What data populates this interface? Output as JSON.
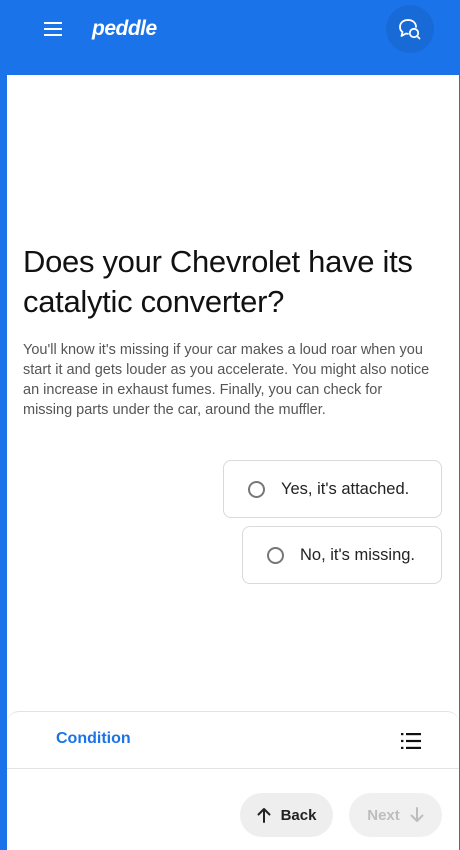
{
  "header": {
    "logo": "peddle",
    "menu_icon": "hamburger-menu-icon",
    "chat_icon": "chat-support-icon"
  },
  "question": {
    "title": "Does your Chevrolet have its catalytic converter?",
    "description": "You'll know it's missing if your car makes a loud roar when you start it and gets louder as you accelerate. You might also notice an increase in exhaust fumes. Finally, you can check for missing parts under the car, around the muffler."
  },
  "options": [
    {
      "label": "Yes, it's attached.",
      "selected": false
    },
    {
      "label": "No, it's missing.",
      "selected": false
    }
  ],
  "footer": {
    "section_label": "Condition",
    "list_icon": "list-icon",
    "back_label": "Back",
    "next_label": "Next",
    "next_enabled": false
  },
  "colors": {
    "brand": "#1a73e8",
    "text": "#111111",
    "muted": "#555555",
    "disabled": "#bdbdbd"
  }
}
